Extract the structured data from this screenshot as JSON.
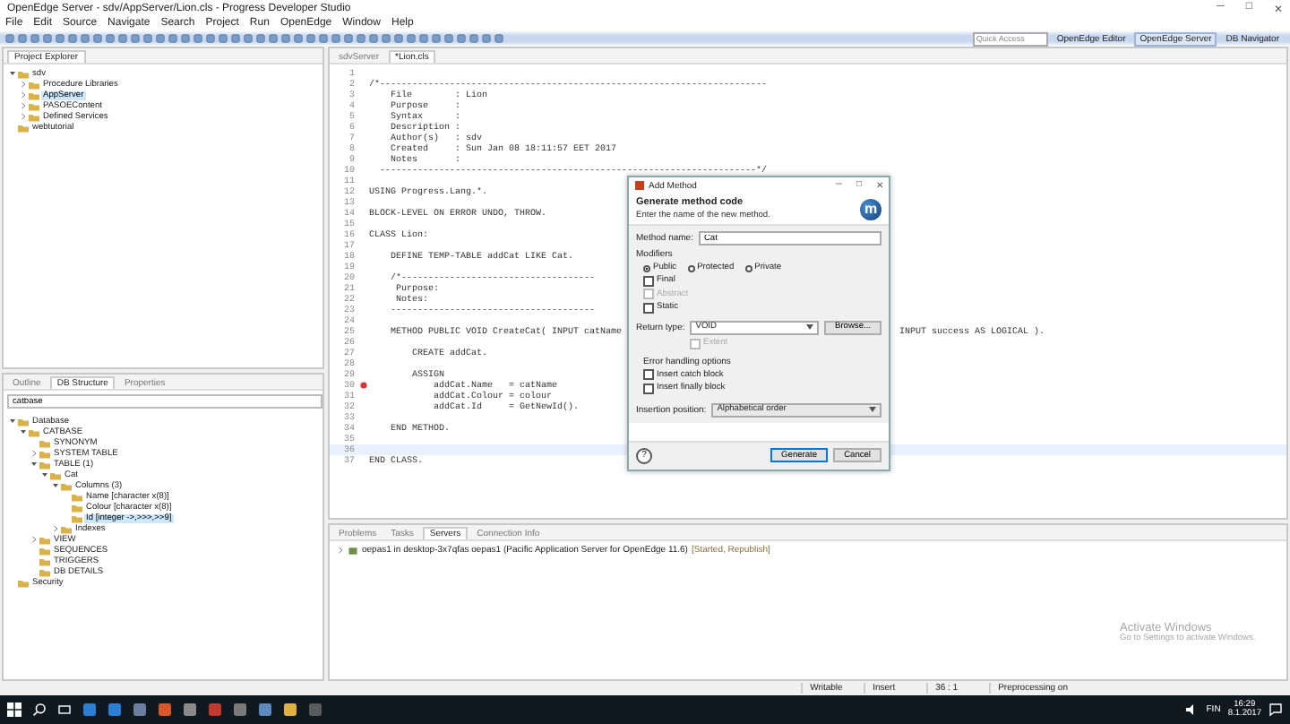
{
  "window": {
    "title": "OpenEdge Server - sdv/AppServer/Lion.cls - Progress Developer Studio",
    "controls": [
      "─",
      "□",
      "✕"
    ]
  },
  "menu": [
    "File",
    "Edit",
    "Source",
    "Navigate",
    "Search",
    "Project",
    "Run",
    "OpenEdge",
    "Window",
    "Help"
  ],
  "toolbar": {
    "quick_access": {
      "placeholder": "Quick Access"
    },
    "perspectives": [
      {
        "label": "OpenEdge Editor",
        "selected": false
      },
      {
        "label": "OpenEdge Server",
        "selected": true
      },
      {
        "label": "DB Navigator",
        "selected": false
      }
    ]
  },
  "project_explorer": {
    "title": "Project Explorer",
    "tree": [
      {
        "label": "sdv",
        "expanded": true,
        "selected": false,
        "children": [
          {
            "label": "Procedure Libraries",
            "expanded": false,
            "selected": false
          },
          {
            "label": "AppServer",
            "expanded": false,
            "selected": true
          },
          {
            "label": "PASOEContent",
            "expanded": false,
            "selected": false
          },
          {
            "label": "Defined Services",
            "expanded": false,
            "selected": false
          }
        ]
      },
      {
        "label": "webtutorial",
        "selected": false
      }
    ]
  },
  "db_structure": {
    "tabs": [
      {
        "label": "Outline",
        "selected": false
      },
      {
        "label": "DB Structure",
        "selected": true
      },
      {
        "label": "Properties",
        "selected": false
      }
    ],
    "filter": "catbase",
    "tree": [
      {
        "label": "Database",
        "expanded": true,
        "selected": false,
        "children": [
          {
            "label": "CATBASE",
            "expanded": true,
            "selected": false,
            "children": [
              {
                "label": "SYNONYM",
                "selected": false
              },
              {
                "label": "SYSTEM TABLE",
                "expanded": false,
                "selected": false
              },
              {
                "label": "TABLE (1)",
                "expanded": true,
                "selected": false,
                "children": [
                  {
                    "label": "Cat",
                    "expanded": true,
                    "selected": false,
                    "children": [
                      {
                        "label": "Columns (3)",
                        "expanded": true,
                        "selected": false,
                        "children": [
                          {
                            "label": "Name [character x(8)]",
                            "selected": false
                          },
                          {
                            "label": "Colour [character x(8)]",
                            "selected": false
                          },
                          {
                            "label": "Id [integer ->,>>>,>>9]",
                            "selected": true
                          }
                        ]
                      },
                      {
                        "label": "Indexes",
                        "expanded": false,
                        "selected": false
                      }
                    ]
                  }
                ]
              },
              {
                "label": "VIEW",
                "expanded": false,
                "selected": false
              },
              {
                "label": "SEQUENCES",
                "selected": false
              },
              {
                "label": "TRIGGERS",
                "selected": false
              },
              {
                "label": "DB DETAILS",
                "selected": false
              }
            ]
          }
        ]
      },
      {
        "label": "Security",
        "selected": false
      }
    ]
  },
  "editor": {
    "tabs": [
      {
        "label": "sdvServer",
        "selected": false
      },
      {
        "label": "*Lion.cls",
        "selected": true
      }
    ],
    "lines": [
      {
        "number": "1",
        "current": false,
        "error": false
      },
      {
        "number": "2",
        "text": "/*------------------------------------------------------------------------",
        "current": false,
        "error": false
      },
      {
        "number": "3",
        "text": "    File        : Lion",
        "current": false,
        "error": false
      },
      {
        "number": "4",
        "text": "    Purpose     :",
        "current": false,
        "error": false
      },
      {
        "number": "5",
        "text": "    Syntax      :",
        "current": false,
        "error": false
      },
      {
        "number": "6",
        "text": "    Description :",
        "current": false,
        "error": false
      },
      {
        "number": "7",
        "text": "    Author(s)   : sdv",
        "current": false,
        "error": false
      },
      {
        "number": "8",
        "text": "    Created     : Sun Jan 08 18:11:57 EET 2017",
        "current": false,
        "error": false
      },
      {
        "number": "9",
        "text": "    Notes       :",
        "current": false,
        "error": false
      },
      {
        "number": "10",
        "text": "  ----------------------------------------------------------------------*/",
        "current": false,
        "error": false
      },
      {
        "number": "11",
        "current": false,
        "error": false
      },
      {
        "number": "12",
        "text": "USING Progress.Lang.*.",
        "current": false,
        "error": false
      },
      {
        "number": "13",
        "current": false,
        "error": false
      },
      {
        "number": "14",
        "text": "BLOCK-LEVEL ON ERROR UNDO, THROW.",
        "current": false,
        "error": false
      },
      {
        "number": "15",
        "current": false,
        "error": false
      },
      {
        "number": "16",
        "text": "CLASS Lion:",
        "current": false,
        "error": false
      },
      {
        "number": "17",
        "current": false,
        "error": false
      },
      {
        "number": "18",
        "text": "    DEFINE TEMP-TABLE addCat LIKE Cat.",
        "current": false,
        "error": false
      },
      {
        "number": "19",
        "current": false,
        "error": false
      },
      {
        "number": "20",
        "text": "    /*------------------------------------",
        "current": false,
        "error": false
      },
      {
        "number": "21",
        "text": "     Purpose:",
        "current": false,
        "error": false
      },
      {
        "number": "22",
        "text": "     Notes:",
        "current": false,
        "error": false
      },
      {
        "number": "23",
        "text": "    --------------------------------------",
        "current": false,
        "error": false
      },
      {
        "number": "24",
        "current": false,
        "error": false
      },
      {
        "number": "25",
        "text": "    METHOD PUBLIC VOID CreateCat( INPUT catName",
        "tail": "INPUT success AS LOGICAL ).",
        "current": false,
        "error": false
      },
      {
        "number": "26",
        "current": false,
        "error": false
      },
      {
        "number": "27",
        "text": "        CREATE addCat.",
        "current": false,
        "error": false
      },
      {
        "number": "28",
        "current": false,
        "error": false
      },
      {
        "number": "29",
        "text": "        ASSIGN",
        "current": false,
        "error": false
      },
      {
        "number": "30",
        "text": "            addCat.Name   = catName",
        "current": false,
        "error": true
      },
      {
        "number": "31",
        "text": "            addCat.Colour = colour",
        "current": false,
        "error": false
      },
      {
        "number": "32",
        "text": "            addCat.Id     = GetNewId().",
        "current": false,
        "error": false
      },
      {
        "number": "33",
        "current": false,
        "error": false
      },
      {
        "number": "34",
        "text": "    END METHOD.",
        "current": false,
        "error": false
      },
      {
        "number": "35",
        "current": false,
        "error": false
      },
      {
        "number": "36",
        "current": true,
        "error": false
      },
      {
        "number": "37",
        "text": "END CLASS.",
        "current": false,
        "error": false
      }
    ]
  },
  "dialog": {
    "title": "Add Method",
    "controls": [
      "─",
      "□",
      "✕"
    ],
    "heading": "Generate method code",
    "message": "Enter the name of the new method.",
    "logo": "m",
    "method_name": {
      "label": "Method name:",
      "value": "Cat"
    },
    "modifiers_label": "Modifiers",
    "access": [
      {
        "label": "Public",
        "selected": true
      },
      {
        "label": "Protected",
        "selected": false
      },
      {
        "label": "Private",
        "selected": false
      }
    ],
    "options": [
      {
        "label": "Final",
        "checked": false,
        "disabled": false
      },
      {
        "label": "Abstract",
        "checked": false,
        "disabled": true
      },
      {
        "label": "Static",
        "checked": false,
        "disabled": false
      }
    ],
    "return_type": {
      "label": "Return type:",
      "value": "VOID"
    },
    "browse_button": "Browse...",
    "extent": {
      "label": "Extent",
      "checked": false,
      "disabled": true
    },
    "error_handling": {
      "label": "Error handling options",
      "options": [
        {
          "label": "Insert catch block",
          "checked": false
        },
        {
          "label": "Insert finally block",
          "checked": false
        }
      ]
    },
    "insertion": {
      "label": "Insertion position:",
      "value": "Alphabetical order"
    },
    "help": "?",
    "buttons": [
      {
        "label": "Generate",
        "default": true
      },
      {
        "label": "Cancel",
        "default": false
      }
    ]
  },
  "servers_panel": {
    "tabs": [
      {
        "label": "Problems",
        "selected": false
      },
      {
        "label": "Tasks",
        "selected": false
      },
      {
        "label": "Servers",
        "selected": true
      },
      {
        "label": "Connection Info",
        "selected": false
      }
    ],
    "rows": [
      {
        "name": "oepas1 in desktop-3x7qfas oepas1 (Pacific Application Server for OpenEdge 11.6)",
        "status": "[Started, Republish]",
        "expanded": false
      }
    ]
  },
  "activation_notice": {
    "title": "Activate Windows",
    "text": "Go to Settings to activate Windows."
  },
  "status_bar": [
    "Writable",
    "Insert",
    "36 : 1",
    "Preprocessing on"
  ],
  "taskbar": {
    "language": "FIN",
    "time": "16:29",
    "date": "8.1.2017"
  }
}
